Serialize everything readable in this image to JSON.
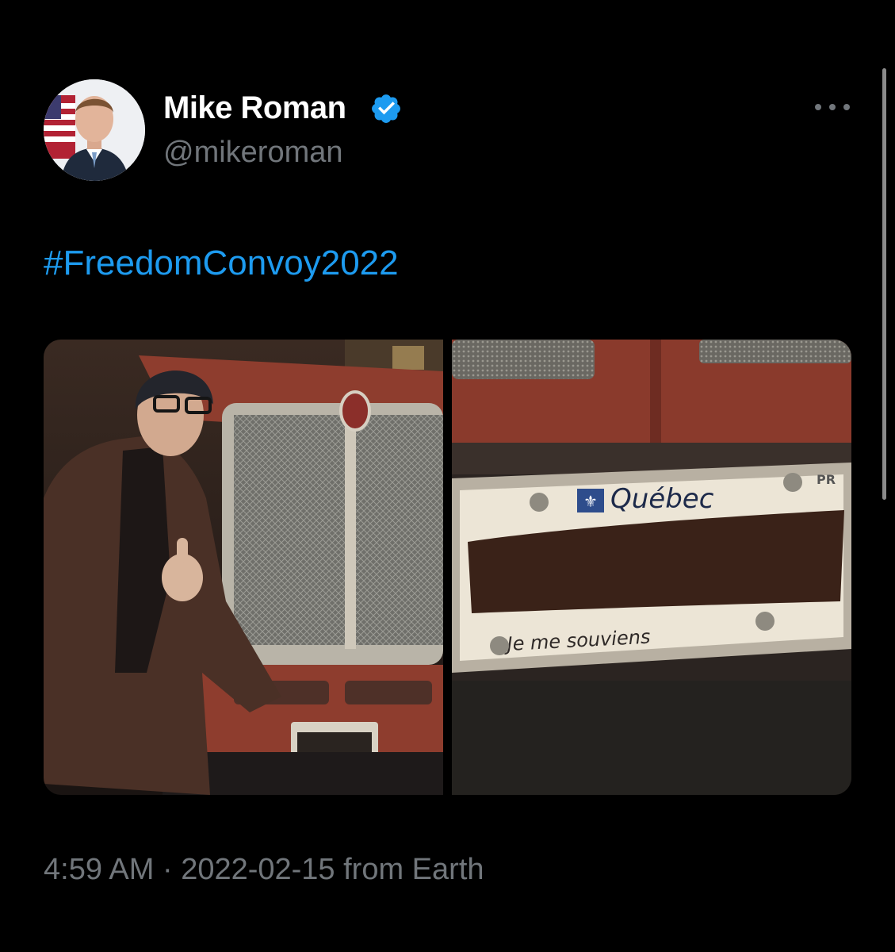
{
  "tweet": {
    "author": {
      "display_name": "Mike Roman",
      "handle": "@mikeroman",
      "verified": true,
      "avatar_icon": "profile-photo"
    },
    "text_hashtag": "#FreedomConvoy2022",
    "media": {
      "count": 2,
      "plate_text_top": "Québec",
      "plate_text_bottom": "Je me souviens",
      "plate_corner_text": "PR"
    },
    "timestamp": "4:59 AM · 2022-02-15 from Earth",
    "more_icon": "ellipsis-icon"
  },
  "colors": {
    "background": "#000000",
    "name": "#ffffff",
    "secondary": "#71767b",
    "link": "#1d9bf0",
    "verified": "#1d9bf0"
  }
}
